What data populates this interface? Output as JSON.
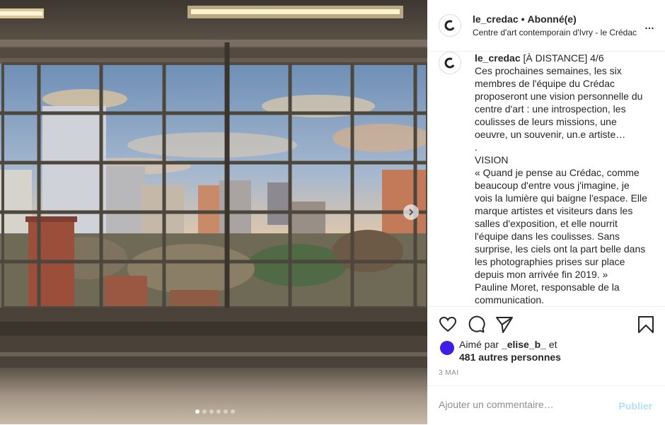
{
  "post": {
    "username": "le_credac",
    "separator": "•",
    "follow_state": "Abonné(e)",
    "location": "Centre d'art contemporain d'Ivry - le Crédac",
    "more_icon": "…"
  },
  "caption": {
    "username": "le_credac",
    "first_line": " [À DISTANCE] 4/6",
    "lines": [
      "Ces prochaines semaines, les six",
      "membres de l'équipe du Crédac",
      "proposeront une vision personnelle du",
      "centre d'art : une introspection, les",
      "coulisses de leurs missions, une",
      "oeuvre, un souvenir, un.e artiste…",
      ".",
      "VISION",
      "« Quand je pense au Crédac, comme",
      "beaucoup d'entre vous j'imagine, je",
      "vois la lumière qui baigne l'espace. Elle",
      "marque artistes et visiteurs dans les",
      "salles d'exposition, et elle nourrit",
      "l'équipe dans les coulisses. Sans",
      "surprise, les ciels ont la part belle dans",
      "les photographies prises sur place",
      "depuis mon arrivée fin 2019. »",
      "Pauline Moret, responsable de la",
      "communication."
    ]
  },
  "likes": {
    "prefix": "Aimé par ",
    "liker": "_elise_b_",
    "suffix": " et",
    "others": "481 autres personnes"
  },
  "date": "3 MAI",
  "comment": {
    "placeholder": "Ajouter un commentaire…",
    "publish_label": "Publier"
  },
  "carousel": {
    "slide_count": 6,
    "active_index": 0
  },
  "colors": {
    "liker_avatar": "#3e1ee6",
    "publish_disabled": "#b2dffc"
  }
}
